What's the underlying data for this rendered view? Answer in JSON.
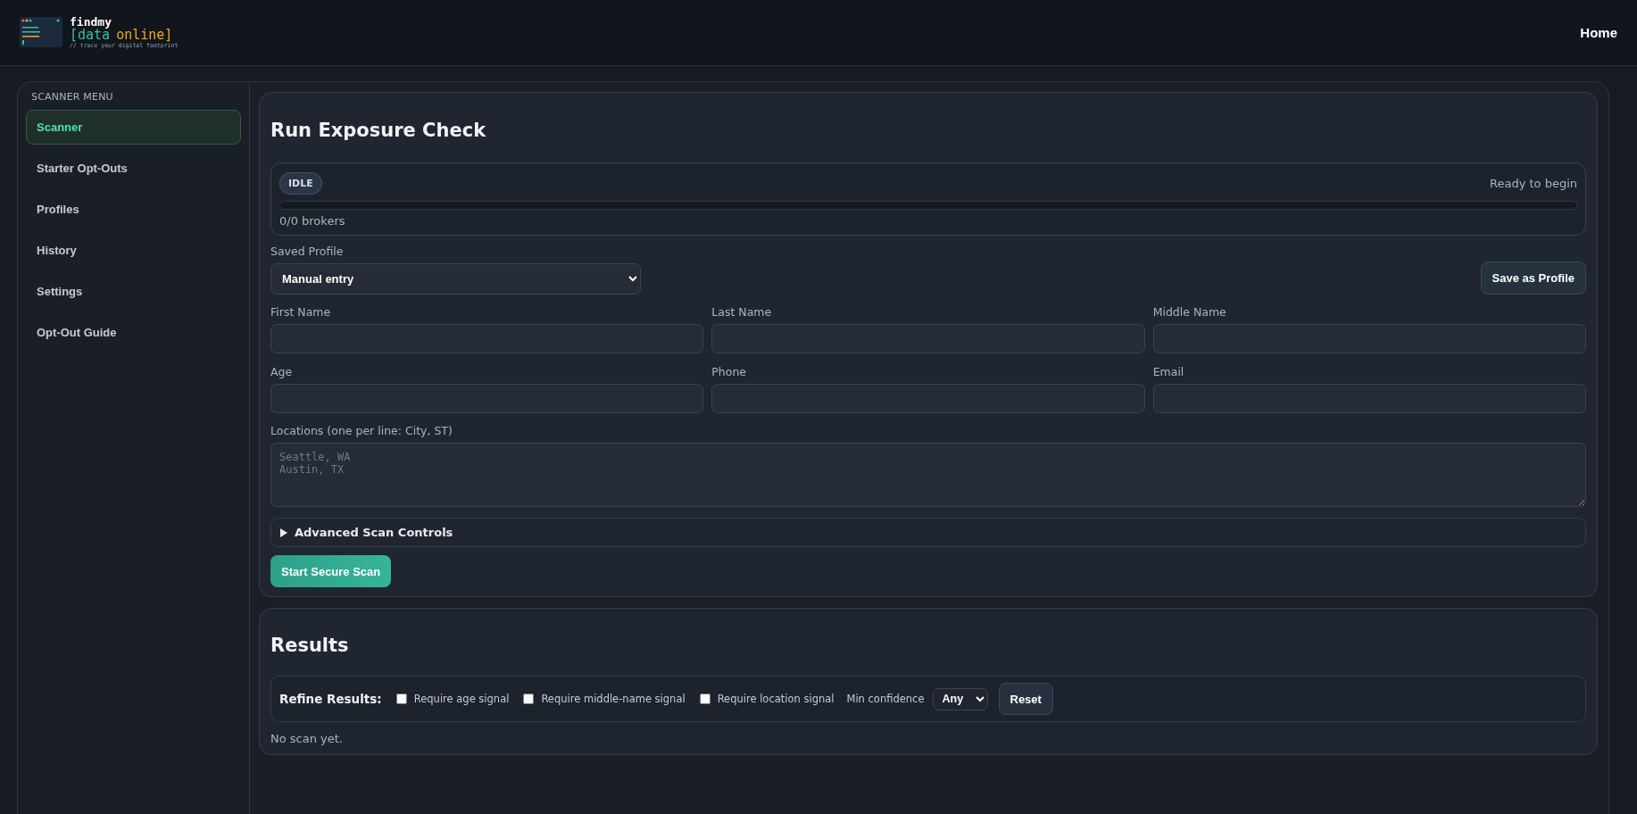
{
  "header": {
    "logo": {
      "name": "findmy",
      "wordmark_parts": [
        {
          "text": "[data",
          "color": "#2ec4a0"
        },
        {
          "text": "online]",
          "color": "#f5a524"
        }
      ],
      "tagline": "// trace your digital footprint"
    },
    "nav": [
      {
        "label": "Home"
      }
    ]
  },
  "sidebar": {
    "title": "SCANNER MENU",
    "items": [
      {
        "label": "Scanner",
        "selected": true
      },
      {
        "label": "Starter Opt-Outs",
        "selected": false
      },
      {
        "label": "Profiles",
        "selected": false
      },
      {
        "label": "History",
        "selected": false
      },
      {
        "label": "Settings",
        "selected": false
      },
      {
        "label": "Opt-Out Guide",
        "selected": false
      }
    ]
  },
  "scan_card": {
    "title": "Run Exposure Check",
    "status": {
      "badge": "IDLE",
      "message": "Ready to begin",
      "level": 0,
      "count": "0/0 brokers"
    },
    "saved_profile": {
      "label": "Saved Profile",
      "value": "Manual entry"
    },
    "save_button": "Save as Profile",
    "fields": [
      {
        "label": "First Name"
      },
      {
        "label": "Last Name"
      },
      {
        "label": "Middle Name"
      },
      {
        "label": "Age"
      },
      {
        "label": "Phone"
      },
      {
        "label": "Email"
      }
    ],
    "locations": {
      "label": "Locations (one per line: City, ST)",
      "placeholder": "Seattle, WA\nAustin, TX"
    },
    "advanced": {
      "label": "Advanced Scan Controls",
      "expanded": false
    },
    "start_button": "Start Secure Scan"
  },
  "results": {
    "title": "Results",
    "refine_label": "Refine Results:",
    "filters": [
      {
        "label": "Require age signal",
        "checked": false
      },
      {
        "label": "Require middle-name signal",
        "checked": false
      },
      {
        "label": "Require location signal",
        "checked": false
      }
    ],
    "min_confidence": {
      "label": "Min confidence",
      "value": "Any"
    },
    "reset_button": "Reset",
    "message": "No scan yet."
  }
}
